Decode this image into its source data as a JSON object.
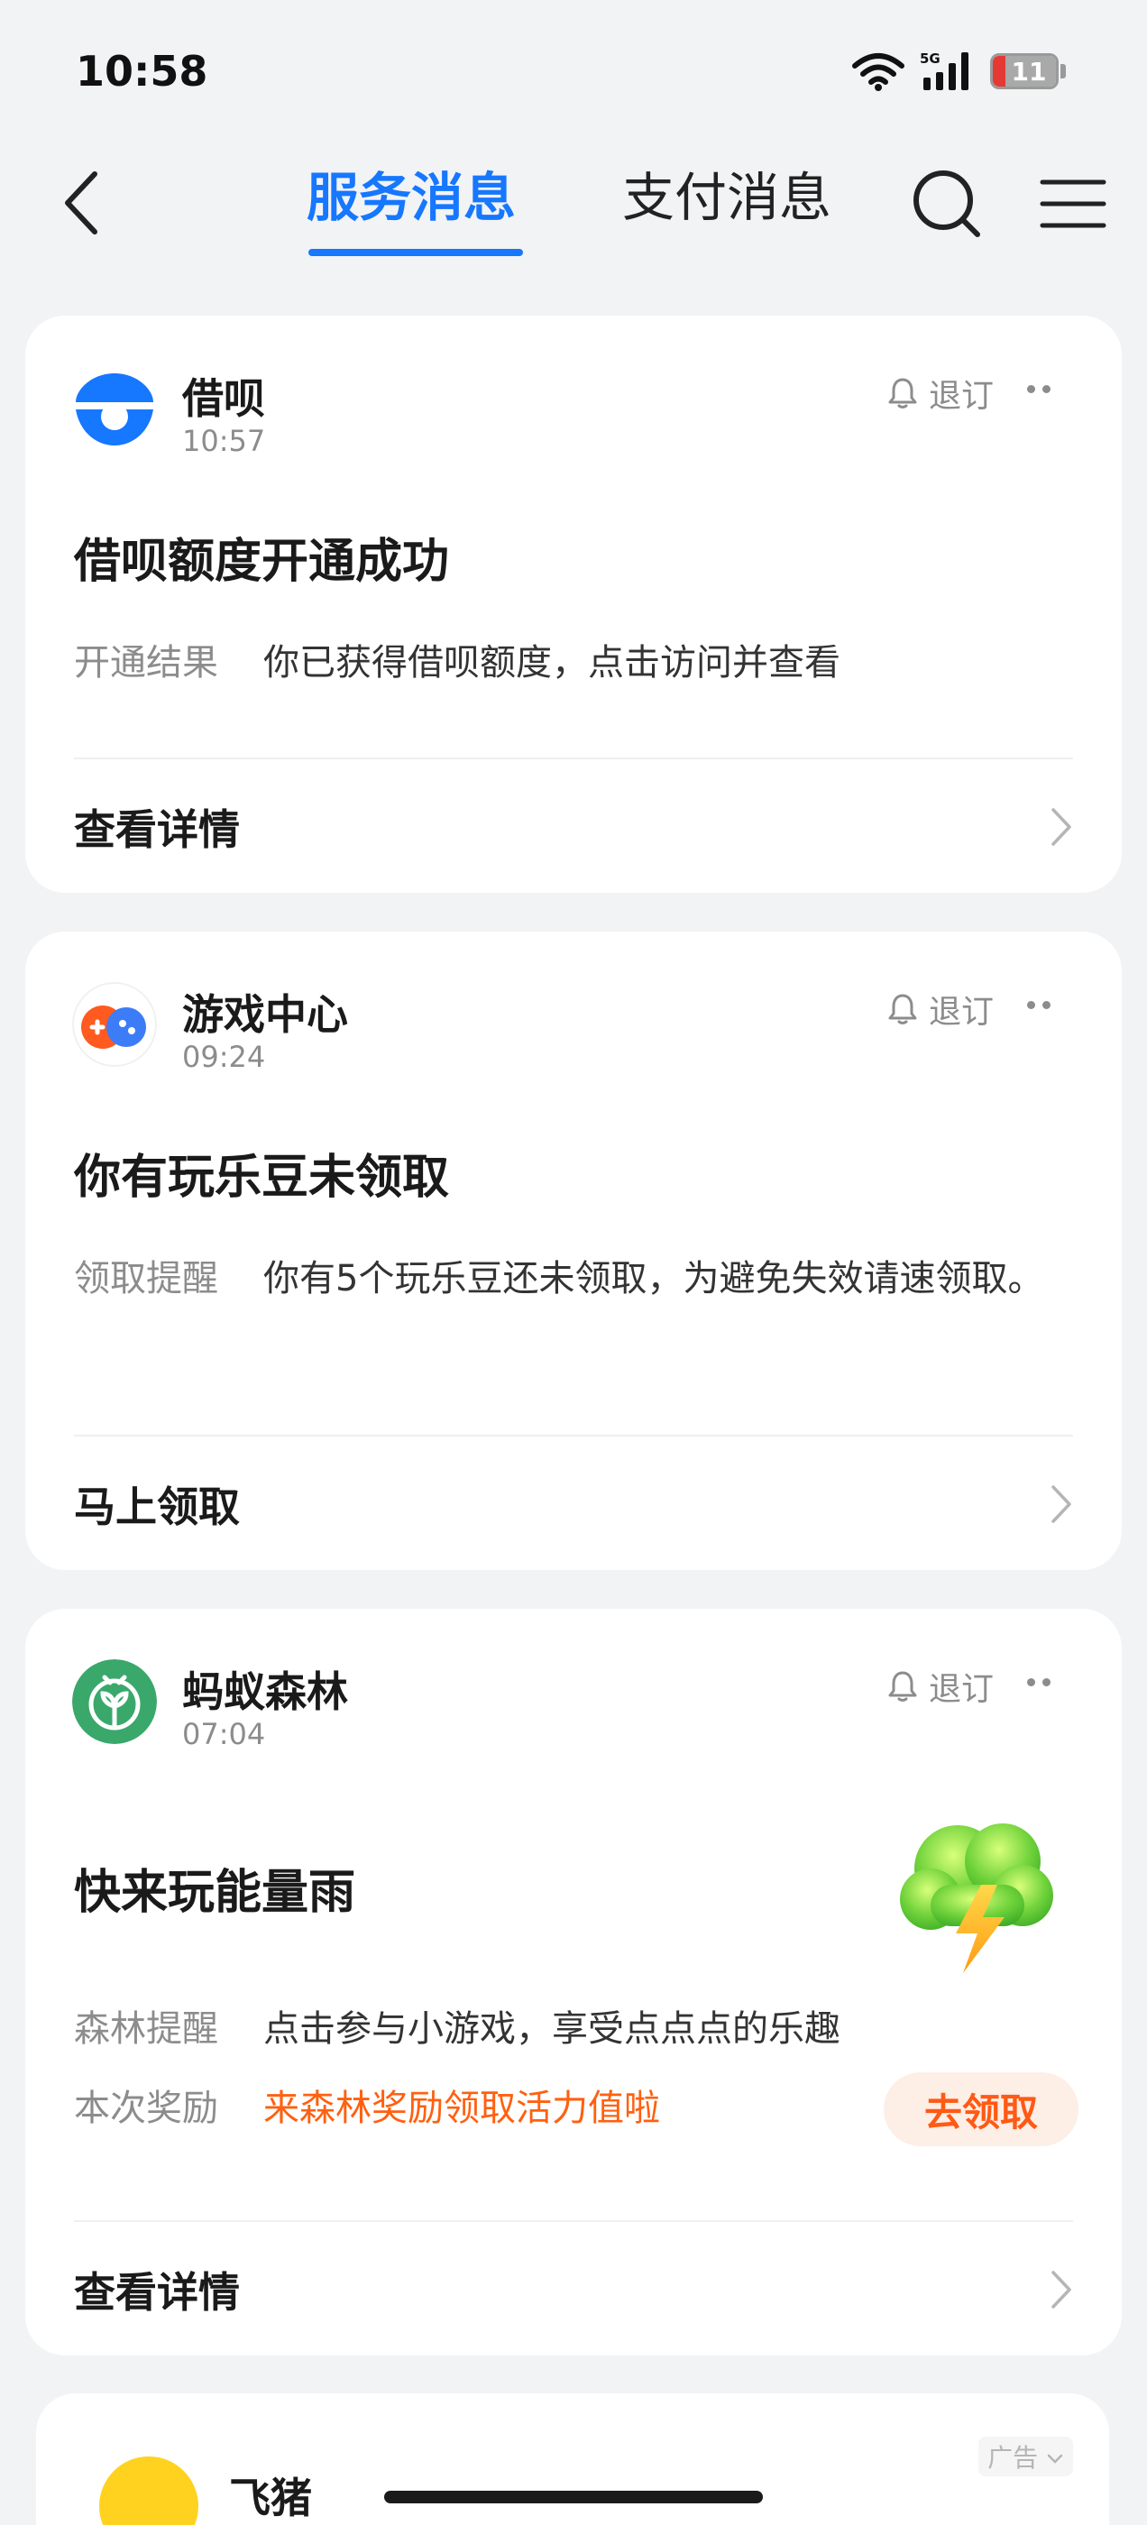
{
  "status_bar": {
    "time": "10:58",
    "network": "5G",
    "battery": "11",
    "battery_color": "#e53935"
  },
  "nav": {
    "tabs": [
      {
        "label": "服务消息",
        "active": true
      },
      {
        "label": "支付消息",
        "active": false
      }
    ],
    "accent": "#1677ff"
  },
  "cards": [
    {
      "service": "借呗",
      "time": "10:57",
      "unsubscribe": "退订",
      "title": "借呗额度开通成功",
      "rows": [
        {
          "label": "开通结果",
          "value": "你已获得借呗额度，点击访问并查看"
        }
      ],
      "action": "查看详情"
    },
    {
      "service": "游戏中心",
      "time": "09:24",
      "unsubscribe": "退订",
      "title": "你有玩乐豆未领取",
      "rows": [
        {
          "label": "领取提醒",
          "value": "你有5个玩乐豆还未领取，为避免失效请速领取。"
        }
      ],
      "action": "马上领取"
    },
    {
      "service": "蚂蚁森林",
      "time": "07:04",
      "unsubscribe": "退订",
      "title": "快来玩能量雨",
      "rows": [
        {
          "label": "森林提醒",
          "value": "点击参与小游戏，享受点点点的乐趣"
        },
        {
          "label": "本次奖励",
          "value": "来森林奖励领取活力值啦"
        }
      ],
      "claim_button": "去领取",
      "action": "查看详情"
    }
  ],
  "ad": {
    "badge": "广告",
    "name": "飞猪"
  },
  "colors": {
    "orange": "#ff6010",
    "gray_text": "#8c8c8c"
  }
}
